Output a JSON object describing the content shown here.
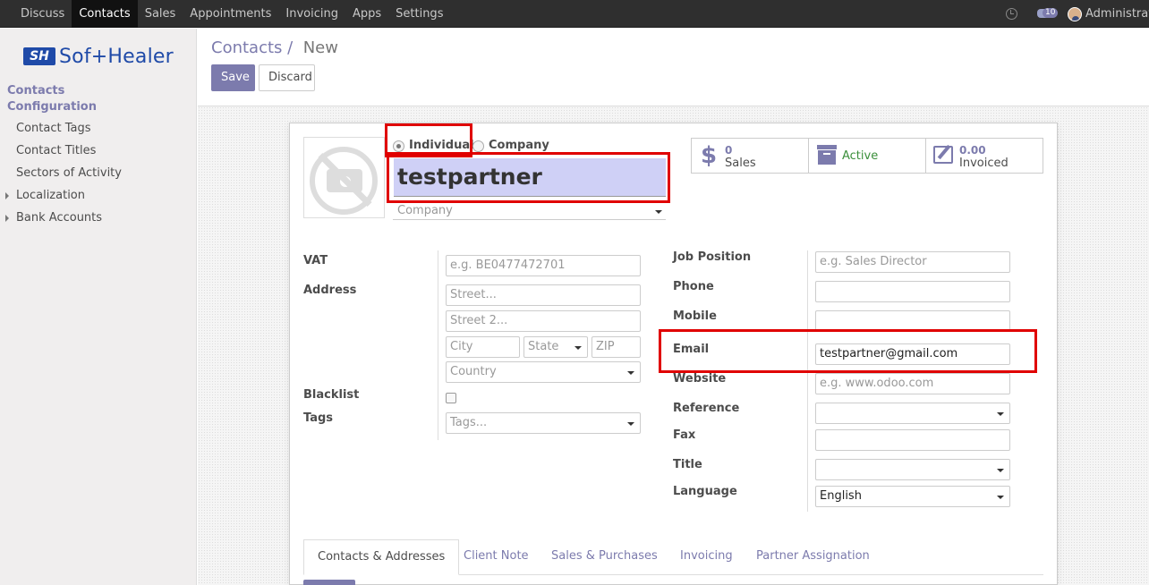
{
  "topbar": {
    "menu": [
      "Discuss",
      "Contacts",
      "Sales",
      "Appointments",
      "Invoicing",
      "Apps",
      "Settings"
    ],
    "active": "Contacts",
    "chat_count": "10",
    "user": "Administrator"
  },
  "sidebar": {
    "logo_mark": "SH",
    "logo_text": "Sof+Healer",
    "headers": [
      "Contacts",
      "Configuration"
    ],
    "items": [
      "Contact Tags",
      "Contact Titles",
      "Sectors of Activity",
      "Localization",
      "Bank Accounts"
    ]
  },
  "breadcrumb": {
    "parent": "Contacts",
    "sep": "/",
    "current": "New"
  },
  "buttons": {
    "save": "Save",
    "discard": "Discard"
  },
  "form": {
    "type_individual": "Individual",
    "type_company": "Company",
    "name": "testpartner",
    "company_placeholder": "Company",
    "stats": {
      "sales_count": "0",
      "sales_label": "Sales",
      "active_label": "Active",
      "invoiced_amount": "0.00",
      "invoiced_label": "Invoiced"
    },
    "left": {
      "vat_label": "VAT",
      "vat_placeholder": "e.g. BE0477472701",
      "address_label": "Address",
      "street_placeholder": "Street...",
      "street2_placeholder": "Street 2...",
      "city_placeholder": "City",
      "state_placeholder": "State",
      "zip_placeholder": "ZIP",
      "country_placeholder": "Country",
      "blacklist_label": "Blacklist",
      "tags_label": "Tags",
      "tags_placeholder": "Tags..."
    },
    "right": {
      "job_label": "Job Position",
      "job_placeholder": "e.g. Sales Director",
      "phone_label": "Phone",
      "mobile_label": "Mobile",
      "email_label": "Email",
      "email_value": "testpartner@gmail.com",
      "website_label": "Website",
      "website_placeholder": "e.g. www.odoo.com",
      "reference_label": "Reference",
      "fax_label": "Fax",
      "title_label": "Title",
      "language_label": "Language",
      "language_value": "English"
    },
    "tabs": [
      "Contacts & Addresses",
      "Client Note",
      "Sales & Purchases",
      "Invoicing",
      "Partner Assignation"
    ],
    "active_tab": "Contacts & Addresses"
  },
  "colors": {
    "primary": "#7c7bad",
    "highlight": "#e00000",
    "name_bg": "#cfd0f6"
  }
}
